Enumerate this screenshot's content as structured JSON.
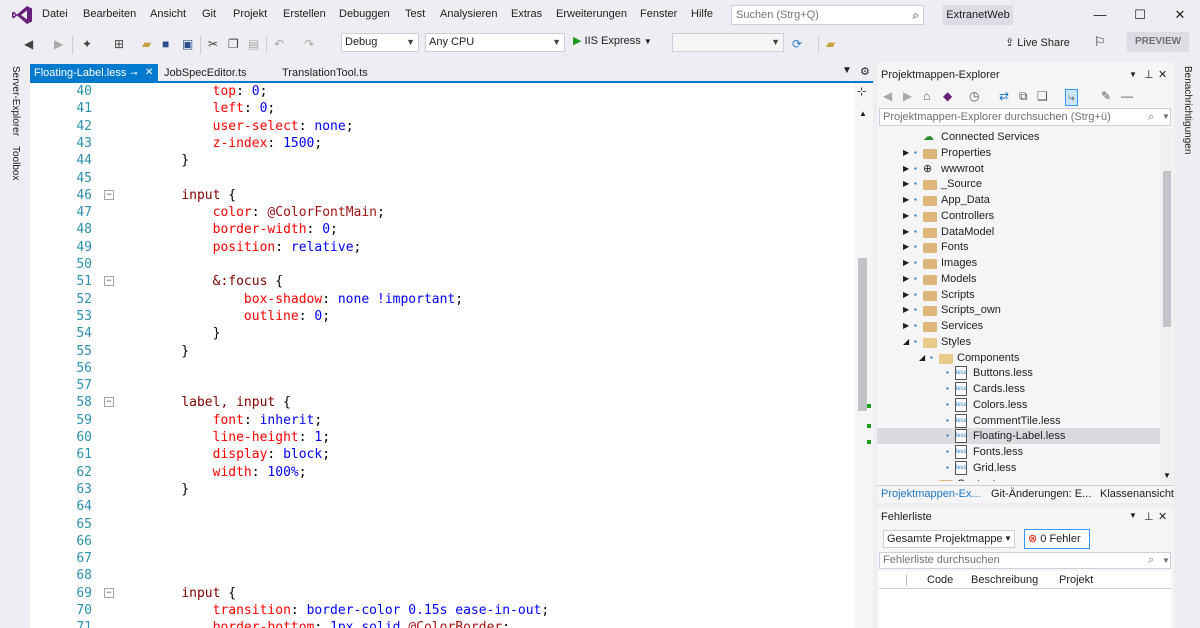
{
  "menu": {
    "items": [
      "Datei",
      "Bearbeiten",
      "Ansicht",
      "Git",
      "Projekt",
      "Erstellen",
      "Debuggen",
      "Test",
      "Analysieren",
      "Extras",
      "Erweiterungen",
      "Fenster",
      "Hilfe"
    ],
    "search_placeholder": "Suchen (Strg+Q)",
    "solution_name": "ExtranetWeb"
  },
  "toolbar": {
    "configuration": "Debug",
    "platform": "Any CPU",
    "run_target": "IIS Express",
    "live_share": "Live Share",
    "preview": "PREVIEW"
  },
  "left_strip": {
    "server_explorer": "Server-Explorer",
    "toolbox": "Toolbox"
  },
  "right_strip": {
    "notifications": "Benachrichtigungen"
  },
  "doc_tabs": [
    {
      "label": "Floating-Label.less",
      "active": true
    },
    {
      "label": "JobSpecEditor.ts",
      "active": false
    },
    {
      "label": "TranslationTool.ts",
      "active": false
    }
  ],
  "editor": {
    "lines": [
      {
        "n": "40",
        "fold": false,
        "tokens": [
          {
            "t": "        ",
            "c": "pun"
          },
          {
            "t": "top",
            "c": "prop"
          },
          {
            "t": ": ",
            "c": "pun"
          },
          {
            "t": "0",
            "c": "val"
          },
          {
            "t": ";",
            "c": "pun"
          }
        ]
      },
      {
        "n": "41",
        "fold": false,
        "tokens": [
          {
            "t": "        ",
            "c": "pun"
          },
          {
            "t": "left",
            "c": "prop"
          },
          {
            "t": ": ",
            "c": "pun"
          },
          {
            "t": "0",
            "c": "val"
          },
          {
            "t": ";",
            "c": "pun"
          }
        ]
      },
      {
        "n": "42",
        "fold": false,
        "tokens": [
          {
            "t": "        ",
            "c": "pun"
          },
          {
            "t": "user-select",
            "c": "prop"
          },
          {
            "t": ": ",
            "c": "pun"
          },
          {
            "t": "none",
            "c": "val"
          },
          {
            "t": ";",
            "c": "pun"
          }
        ]
      },
      {
        "n": "43",
        "fold": false,
        "tokens": [
          {
            "t": "        ",
            "c": "pun"
          },
          {
            "t": "z-index",
            "c": "prop"
          },
          {
            "t": ": ",
            "c": "pun"
          },
          {
            "t": "1500",
            "c": "val"
          },
          {
            "t": ";",
            "c": "pun"
          }
        ]
      },
      {
        "n": "44",
        "fold": false,
        "tokens": [
          {
            "t": "    }",
            "c": "pun"
          }
        ]
      },
      {
        "n": "45",
        "fold": false,
        "tokens": []
      },
      {
        "n": "46",
        "fold": true,
        "tokens": [
          {
            "t": "    ",
            "c": "pun"
          },
          {
            "t": "input",
            "c": "sel"
          },
          {
            "t": " {",
            "c": "pun"
          }
        ]
      },
      {
        "n": "47",
        "fold": false,
        "tokens": [
          {
            "t": "        ",
            "c": "pun"
          },
          {
            "t": "color",
            "c": "prop"
          },
          {
            "t": ": ",
            "c": "pun"
          },
          {
            "t": "@ColorFontMain",
            "c": "var"
          },
          {
            "t": ";",
            "c": "pun"
          }
        ]
      },
      {
        "n": "48",
        "fold": false,
        "tokens": [
          {
            "t": "        ",
            "c": "pun"
          },
          {
            "t": "border-width",
            "c": "prop"
          },
          {
            "t": ": ",
            "c": "pun"
          },
          {
            "t": "0",
            "c": "val"
          },
          {
            "t": ";",
            "c": "pun"
          }
        ]
      },
      {
        "n": "49",
        "fold": false,
        "tokens": [
          {
            "t": "        ",
            "c": "pun"
          },
          {
            "t": "position",
            "c": "prop"
          },
          {
            "t": ": ",
            "c": "pun"
          },
          {
            "t": "relative",
            "c": "val"
          },
          {
            "t": ";",
            "c": "pun"
          }
        ]
      },
      {
        "n": "50",
        "fold": false,
        "tokens": []
      },
      {
        "n": "51",
        "fold": true,
        "tokens": [
          {
            "t": "        ",
            "c": "pun"
          },
          {
            "t": "&:focus",
            "c": "sel"
          },
          {
            "t": " {",
            "c": "pun"
          }
        ]
      },
      {
        "n": "52",
        "fold": false,
        "tokens": [
          {
            "t": "            ",
            "c": "pun"
          },
          {
            "t": "box-shadow",
            "c": "prop"
          },
          {
            "t": ": ",
            "c": "pun"
          },
          {
            "t": "none !important",
            "c": "val"
          },
          {
            "t": ";",
            "c": "pun"
          }
        ]
      },
      {
        "n": "53",
        "fold": false,
        "tokens": [
          {
            "t": "            ",
            "c": "pun"
          },
          {
            "t": "outline",
            "c": "prop"
          },
          {
            "t": ": ",
            "c": "pun"
          },
          {
            "t": "0",
            "c": "val"
          },
          {
            "t": ";",
            "c": "pun"
          }
        ]
      },
      {
        "n": "54",
        "fold": false,
        "tokens": [
          {
            "t": "        }",
            "c": "pun"
          }
        ]
      },
      {
        "n": "55",
        "fold": false,
        "tokens": [
          {
            "t": "    }",
            "c": "pun"
          }
        ]
      },
      {
        "n": "56",
        "fold": false,
        "tokens": []
      },
      {
        "n": "57",
        "fold": false,
        "tokens": []
      },
      {
        "n": "58",
        "fold": true,
        "tokens": [
          {
            "t": "    ",
            "c": "pun"
          },
          {
            "t": "label, input",
            "c": "sel"
          },
          {
            "t": " {",
            "c": "pun"
          }
        ]
      },
      {
        "n": "59",
        "fold": false,
        "tokens": [
          {
            "t": "        ",
            "c": "pun"
          },
          {
            "t": "font",
            "c": "prop"
          },
          {
            "t": ": ",
            "c": "pun"
          },
          {
            "t": "inherit",
            "c": "val"
          },
          {
            "t": ";",
            "c": "pun"
          }
        ]
      },
      {
        "n": "60",
        "fold": false,
        "tokens": [
          {
            "t": "        ",
            "c": "pun"
          },
          {
            "t": "line-height",
            "c": "prop"
          },
          {
            "t": ": ",
            "c": "pun"
          },
          {
            "t": "1",
            "c": "val"
          },
          {
            "t": ";",
            "c": "pun"
          }
        ]
      },
      {
        "n": "61",
        "fold": false,
        "tokens": [
          {
            "t": "        ",
            "c": "pun"
          },
          {
            "t": "display",
            "c": "prop"
          },
          {
            "t": ": ",
            "c": "pun"
          },
          {
            "t": "block",
            "c": "val"
          },
          {
            "t": ";",
            "c": "pun"
          }
        ]
      },
      {
        "n": "62",
        "fold": false,
        "tokens": [
          {
            "t": "        ",
            "c": "pun"
          },
          {
            "t": "width",
            "c": "prop"
          },
          {
            "t": ": ",
            "c": "pun"
          },
          {
            "t": "100%",
            "c": "val"
          },
          {
            "t": ";",
            "c": "pun"
          }
        ]
      },
      {
        "n": "63",
        "fold": false,
        "tokens": [
          {
            "t": "    }",
            "c": "pun"
          }
        ]
      },
      {
        "n": "64",
        "fold": false,
        "tokens": []
      },
      {
        "n": "65",
        "fold": false,
        "tokens": []
      },
      {
        "n": "66",
        "fold": false,
        "tokens": []
      },
      {
        "n": "67",
        "fold": false,
        "tokens": []
      },
      {
        "n": "68",
        "fold": false,
        "tokens": []
      },
      {
        "n": "69",
        "fold": true,
        "tokens": [
          {
            "t": "    ",
            "c": "pun"
          },
          {
            "t": "input",
            "c": "sel"
          },
          {
            "t": " {",
            "c": "pun"
          }
        ]
      },
      {
        "n": "70",
        "fold": false,
        "tokens": [
          {
            "t": "        ",
            "c": "pun"
          },
          {
            "t": "transition",
            "c": "prop"
          },
          {
            "t": ": ",
            "c": "pun"
          },
          {
            "t": "border-color 0.15s ease-in-out",
            "c": "val"
          },
          {
            "t": ";",
            "c": "pun"
          }
        ]
      },
      {
        "n": "71",
        "fold": false,
        "tokens": [
          {
            "t": "        ",
            "c": "pun"
          },
          {
            "t": "border-bottom",
            "c": "prop"
          },
          {
            "t": ": ",
            "c": "pun"
          },
          {
            "t": "1px solid ",
            "c": "val"
          },
          {
            "t": "@ColorBorder",
            "c": "var"
          },
          {
            "t": ";",
            "c": "pun"
          }
        ]
      }
    ]
  },
  "solution_explorer": {
    "title": "Projektmappen-Explorer",
    "search_placeholder": "Projektmappen-Explorer durchsuchen (Strg+ü)",
    "nodes": [
      {
        "label": "Connected Services",
        "depth": 0,
        "kind": "service",
        "exp": ""
      },
      {
        "label": "Properties",
        "depth": 0,
        "kind": "folder",
        "exp": "▶"
      },
      {
        "label": "wwwroot",
        "depth": 0,
        "kind": "globe",
        "exp": "▶"
      },
      {
        "label": "_Source",
        "depth": 0,
        "kind": "folder",
        "exp": "▶"
      },
      {
        "label": "App_Data",
        "depth": 0,
        "kind": "folder",
        "exp": "▶"
      },
      {
        "label": "Controllers",
        "depth": 0,
        "kind": "folder",
        "exp": "▶"
      },
      {
        "label": "DataModel",
        "depth": 0,
        "kind": "folder",
        "exp": "▶"
      },
      {
        "label": "Fonts",
        "depth": 0,
        "kind": "folder",
        "exp": "▶"
      },
      {
        "label": "Images",
        "depth": 0,
        "kind": "folder",
        "exp": "▶"
      },
      {
        "label": "Models",
        "depth": 0,
        "kind": "folder",
        "exp": "▶"
      },
      {
        "label": "Scripts",
        "depth": 0,
        "kind": "folder",
        "exp": "▶"
      },
      {
        "label": "Scripts_own",
        "depth": 0,
        "kind": "folder",
        "exp": "▶"
      },
      {
        "label": "Services",
        "depth": 0,
        "kind": "folder",
        "exp": "▶"
      },
      {
        "label": "Styles",
        "depth": 0,
        "kind": "folder-open",
        "exp": "◢"
      },
      {
        "label": "Components",
        "depth": 1,
        "kind": "folder-open",
        "exp": "◢"
      },
      {
        "label": "Buttons.less",
        "depth": 2,
        "kind": "file",
        "exp": ""
      },
      {
        "label": "Cards.less",
        "depth": 2,
        "kind": "file",
        "exp": ""
      },
      {
        "label": "Colors.less",
        "depth": 2,
        "kind": "file",
        "exp": ""
      },
      {
        "label": "CommentTile.less",
        "depth": 2,
        "kind": "file",
        "exp": ""
      },
      {
        "label": "Floating-Label.less",
        "depth": 2,
        "kind": "file",
        "exp": "",
        "selected": true
      },
      {
        "label": "Fonts.less",
        "depth": 2,
        "kind": "file",
        "exp": ""
      },
      {
        "label": "Grid.less",
        "depth": 2,
        "kind": "file",
        "exp": ""
      },
      {
        "label": "Content",
        "depth": 1,
        "kind": "folder",
        "exp": "▶"
      }
    ],
    "tabs": [
      "Projektmappen-Ex...",
      "Git-Änderungen: E...",
      "Klassenansicht"
    ]
  },
  "error_list": {
    "title": "Fehlerliste",
    "scope": "Gesamte Projektmappe",
    "errors_label": "0 Fehler",
    "search_placeholder": "Fehlerliste durchsuchen",
    "columns": [
      "Code",
      "Beschreibung",
      "Projekt"
    ]
  },
  "colors": {
    "accent": "#007acc",
    "chrome": "#eeeef2",
    "line_number": "#2b91af",
    "property": "#ff0000",
    "value": "#0000ff",
    "selector": "#800000"
  }
}
